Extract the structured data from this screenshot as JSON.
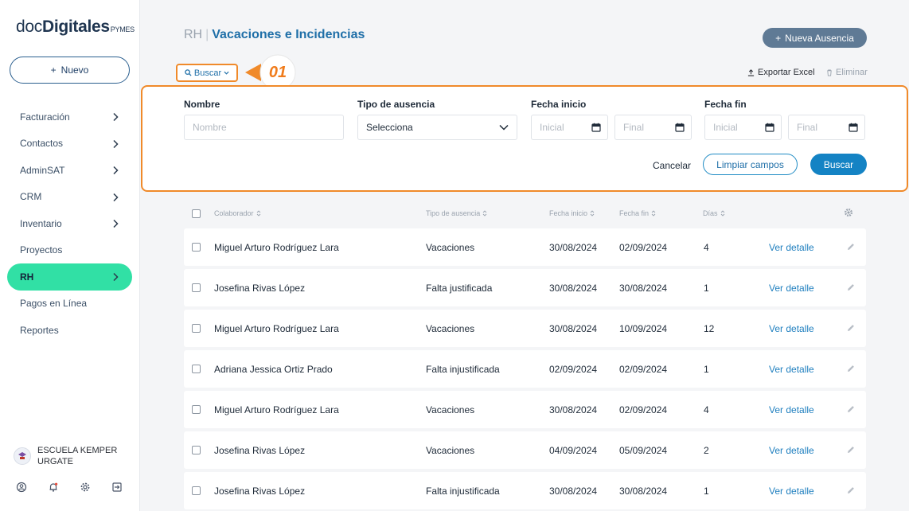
{
  "logo": {
    "part1": "doc",
    "part2": "Digitales",
    "part3": "PYMES"
  },
  "sidebar": {
    "new_label": "Nuevo",
    "items": [
      {
        "label": "Facturación",
        "chevron": true
      },
      {
        "label": "Contactos",
        "chevron": true
      },
      {
        "label": "AdminSAT",
        "chevron": true
      },
      {
        "label": "CRM",
        "chevron": true
      },
      {
        "label": "Inventario",
        "chevron": true
      },
      {
        "label": "Proyectos",
        "chevron": false
      },
      {
        "label": "RH",
        "chevron": true,
        "active": true
      },
      {
        "label": "Pagos en Línea",
        "chevron": false
      },
      {
        "label": "Reportes",
        "chevron": false
      }
    ],
    "company": "ESCUELA KEMPER URGATE",
    "bottom_icons": [
      "user-icon",
      "bell-icon",
      "gear-icon",
      "logout-icon"
    ]
  },
  "header": {
    "breadcrumb": "RH",
    "separator": "|",
    "title": "Vacaciones e Incidencias",
    "new_button": "Nueva Ausencia"
  },
  "toolbar": {
    "search_toggle": "Buscar",
    "export": "Exportar Excel",
    "delete": "Eliminar",
    "callout": "01"
  },
  "search": {
    "name_label": "Nombre",
    "name_placeholder": "Nombre",
    "type_label": "Tipo de ausencia",
    "type_value": "Selecciona",
    "start_label": "Fecha inicio",
    "end_label": "Fecha fin",
    "initial_placeholder": "Inicial",
    "final_placeholder": "Final",
    "cancel": "Cancelar",
    "clear": "Limpiar campos",
    "submit": "Buscar"
  },
  "table": {
    "columns": [
      "Colaborador",
      "Tipo de ausencia",
      "Fecha inicio",
      "Fecha fin",
      "Días"
    ],
    "detail_label": "Ver detalle",
    "rows": [
      {
        "colaborador": "Miguel Arturo Rodríguez Lara",
        "tipo": "Vacaciones",
        "inicio": "30/08/2024",
        "fin": "02/09/2024",
        "dias": "4"
      },
      {
        "colaborador": "Josefina Rivas López",
        "tipo": "Falta justificada",
        "inicio": "30/08/2024",
        "fin": "30/08/2024",
        "dias": "1"
      },
      {
        "colaborador": "Miguel Arturo Rodríguez Lara",
        "tipo": "Vacaciones",
        "inicio": "30/08/2024",
        "fin": "10/09/2024",
        "dias": "12"
      },
      {
        "colaborador": "Adriana Jessica Ortiz Prado",
        "tipo": "Falta injustificada",
        "inicio": "02/09/2024",
        "fin": "02/09/2024",
        "dias": "1"
      },
      {
        "colaborador": "Miguel Arturo Rodríguez Lara",
        "tipo": "Vacaciones",
        "inicio": "30/08/2024",
        "fin": "02/09/2024",
        "dias": "4"
      },
      {
        "colaborador": "Josefina Rivas López",
        "tipo": "Vacaciones",
        "inicio": "04/09/2024",
        "fin": "05/09/2024",
        "dias": "2"
      },
      {
        "colaborador": "Josefina Rivas López",
        "tipo": "Falta injustificada",
        "inicio": "30/08/2024",
        "fin": "30/08/2024",
        "dias": "1"
      }
    ]
  },
  "colors": {
    "accent": "#1f6fa8",
    "active_nav": "#31e0a5",
    "highlight": "#f08a2a",
    "primary_button": "#1483c4",
    "secondary_button": "#5f7a95"
  }
}
